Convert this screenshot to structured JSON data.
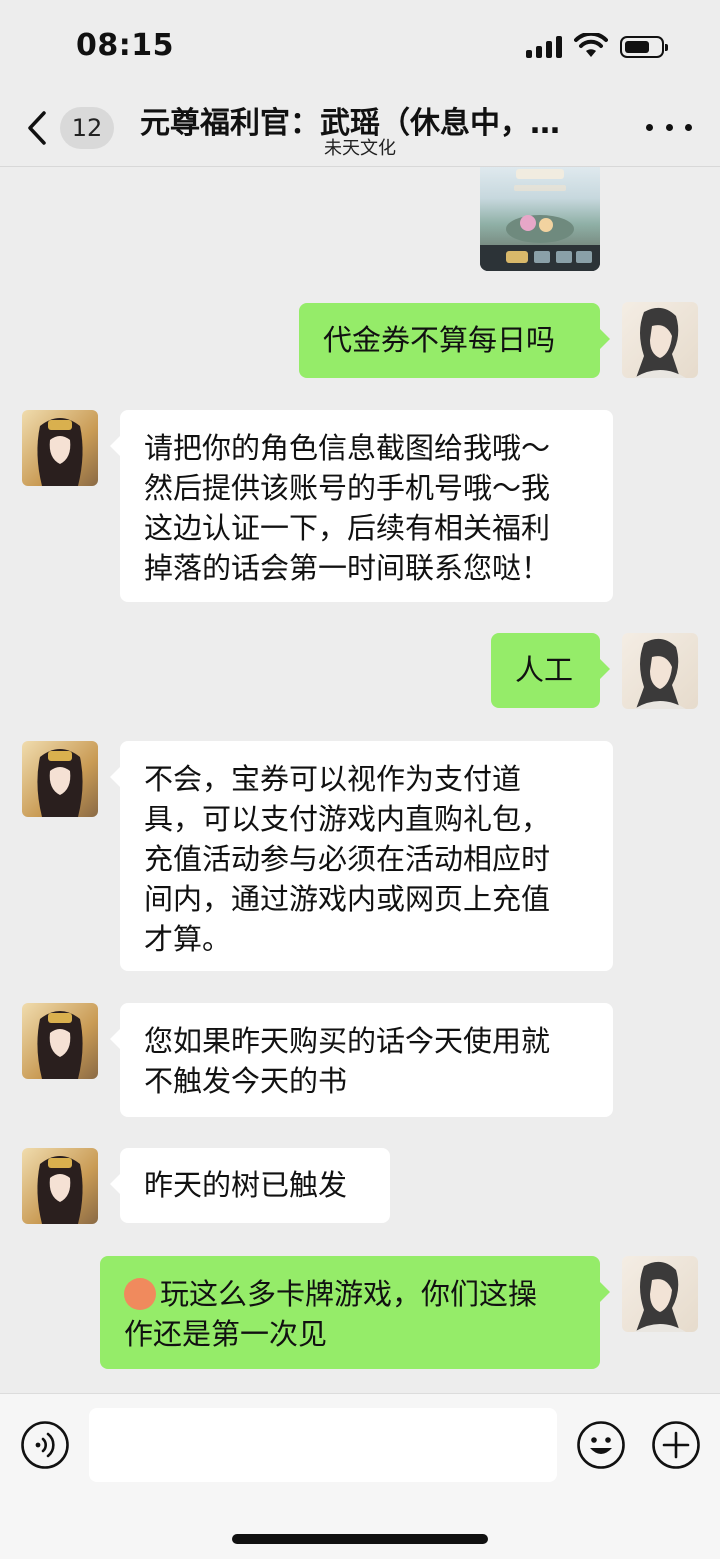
{
  "status": {
    "time": "08:15"
  },
  "nav": {
    "unread_count": "12",
    "title": "元尊福利官：武瑶（休息中，…",
    "subtitle": "未天文化"
  },
  "messages": [
    {
      "side": "right",
      "text": "代金券不算每日吗"
    },
    {
      "side": "left",
      "lines": [
        "请把你的角色信息截图给我哦～",
        "然后提供该账号的手机号哦～我",
        "这边认证一下，后续有相关福利",
        "掉落的话会第一时间联系您哒！"
      ]
    },
    {
      "side": "right",
      "text": "人工"
    },
    {
      "side": "left",
      "lines": [
        "不会，宝券可以视作为支付道",
        "具，可以支付游戏内直购礼包，",
        "充值活动参与必须在活动相应时",
        "间内，通过游戏内或网页上充值",
        "才算。"
      ]
    },
    {
      "side": "left",
      "lines": [
        "您如果昨天购买的话今天使用就",
        "不触发今天的书"
      ]
    },
    {
      "side": "left",
      "text": "昨天的树已触发"
    },
    {
      "side": "right",
      "lines": [
        "玩这么多卡牌游戏，你们这操",
        "作还是第一次见"
      ],
      "emoji": "hot-face"
    }
  ],
  "colors": {
    "self_bubble": "#95ec69",
    "other_bubble": "#ffffff",
    "background": "#ededed"
  }
}
